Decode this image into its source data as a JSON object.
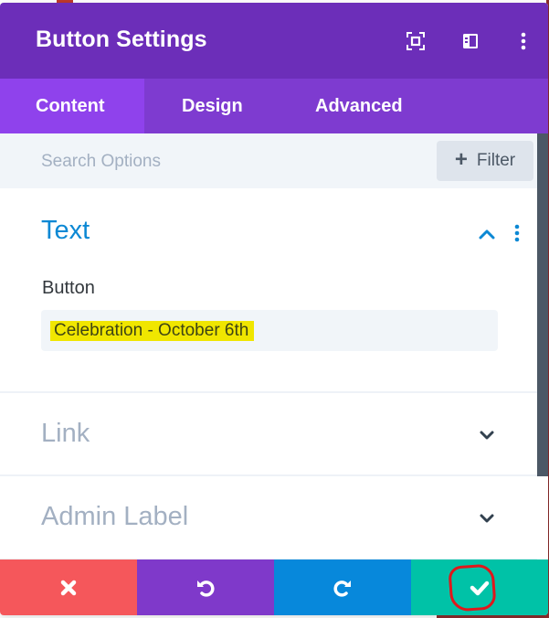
{
  "header": {
    "title": "Button Settings",
    "icons": [
      "expand-icon",
      "split-view-icon",
      "more-options-icon"
    ]
  },
  "tabs": [
    {
      "label": "Content",
      "active": true
    },
    {
      "label": "Design",
      "active": false
    },
    {
      "label": "Advanced",
      "active": false
    }
  ],
  "search": {
    "placeholder": "Search Options",
    "value": "",
    "filter_label": "Filter",
    "filter_icon": "plus-icon"
  },
  "sections": {
    "text": {
      "title": "Text",
      "expanded": true,
      "field_label": "Button",
      "field_value": "Celebration - October 6th"
    },
    "link": {
      "title": "Link",
      "expanded": false
    },
    "admin": {
      "title": "Admin Label",
      "expanded": false
    }
  },
  "footer": {
    "buttons": [
      {
        "name": "cancel",
        "icon": "close-icon",
        "color": "#f5575b"
      },
      {
        "name": "undo",
        "icon": "undo-icon",
        "color": "#7f39ca"
      },
      {
        "name": "redo",
        "icon": "redo-icon",
        "color": "#0788db"
      },
      {
        "name": "save",
        "icon": "check-icon",
        "color": "#00c2a7"
      }
    ]
  },
  "colors": {
    "header": "#6c2eb9",
    "tabs": "#7e3bd0",
    "tab_active": "#8f42ec",
    "accent_blue": "#0c88d4",
    "highlight": "#f0e600"
  }
}
